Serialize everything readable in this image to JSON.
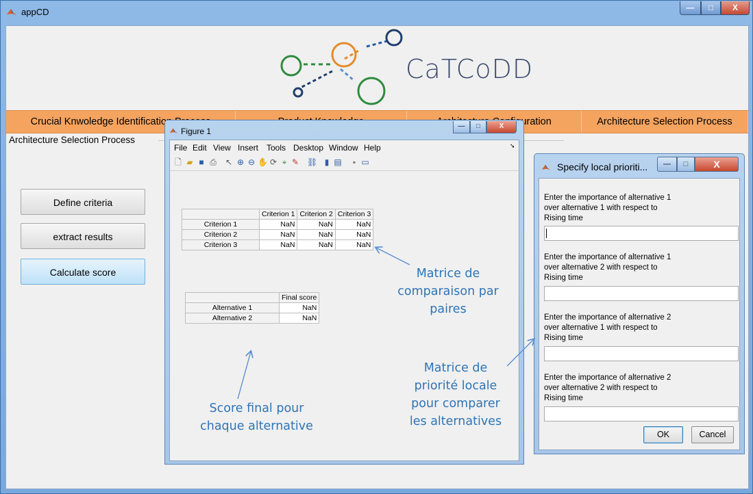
{
  "app": {
    "title": "appCD",
    "logo_text": "CaTCoDD",
    "colors": {
      "tab_bar": "#f4a15a",
      "annotation": "#2e74b5",
      "selected_button": "#bfe1f7"
    }
  },
  "window_controls": {
    "minimize": "—",
    "maximize": "□",
    "close": "X"
  },
  "tabs": [
    {
      "label": "Crucial Knwoledge Identification Process"
    },
    {
      "label": "Product Knowledge"
    },
    {
      "label": "Architecture Configuration"
    },
    {
      "label": "Architecture Selection Process"
    }
  ],
  "panel": {
    "title": "Architecture Selection Process",
    "buttons": [
      {
        "label": "Define criteria"
      },
      {
        "label": "extract results"
      },
      {
        "label": "Calculate score"
      }
    ]
  },
  "figure": {
    "title": "Figure 1",
    "menu": [
      "File",
      "Edit",
      "View",
      "Insert",
      "Tools",
      "Desktop",
      "Window",
      "Help"
    ],
    "toolbar_icons": [
      "new-file-icon",
      "open-folder-icon",
      "save-icon",
      "print-icon",
      "pointer-icon",
      "zoom-in-icon",
      "zoom-out-icon",
      "pan-icon",
      "rotate-icon",
      "data-cursor-icon",
      "brush-icon",
      "link-icon",
      "colorbar-icon",
      "legend-icon",
      "hide-tools-icon",
      "show-tools-icon"
    ],
    "criteria_table": {
      "columns": [
        "",
        "Criterion 1",
        "Criterion 2",
        "Criterion 3"
      ],
      "rows": [
        {
          "label": "Criterion 1",
          "values": [
            "NaN",
            "NaN",
            "NaN"
          ]
        },
        {
          "label": "Criterion 2",
          "values": [
            "NaN",
            "NaN",
            "NaN"
          ]
        },
        {
          "label": "Criterion 3",
          "values": [
            "NaN",
            "NaN",
            "NaN"
          ]
        }
      ]
    },
    "score_table": {
      "columns": [
        "",
        "Final score"
      ],
      "rows": [
        {
          "label": "Alternative 1",
          "value": "NaN"
        },
        {
          "label": "Alternative 2",
          "value": "NaN"
        }
      ]
    }
  },
  "annotations": {
    "pairwise": [
      "Matrice de",
      "comparaison par",
      "paires"
    ],
    "final_score": [
      "Score final pour",
      "chaque alternative"
    ],
    "local_priority": [
      "Matrice de",
      "priorité locale",
      "pour comparer",
      "les alternatives"
    ]
  },
  "dialog": {
    "title": "Specify local prioriti...",
    "prompts": [
      {
        "lines": [
          "Enter the importance of alternative 1",
          "over alternative 1 with respect to",
          "Rising time"
        ],
        "value": ""
      },
      {
        "lines": [
          "Enter the importance of alternative 1",
          "over alternative 2 with respect to",
          "Rising time"
        ],
        "value": ""
      },
      {
        "lines": [
          "Enter the importance of alternative 2",
          "over alternative 1 with respect to",
          "Rising time"
        ],
        "value": ""
      },
      {
        "lines": [
          "Enter the importance of alternative 2",
          "over alternative 2 with respect to",
          "Rising time"
        ],
        "value": ""
      }
    ],
    "ok_label": "OK",
    "cancel_label": "Cancel"
  }
}
